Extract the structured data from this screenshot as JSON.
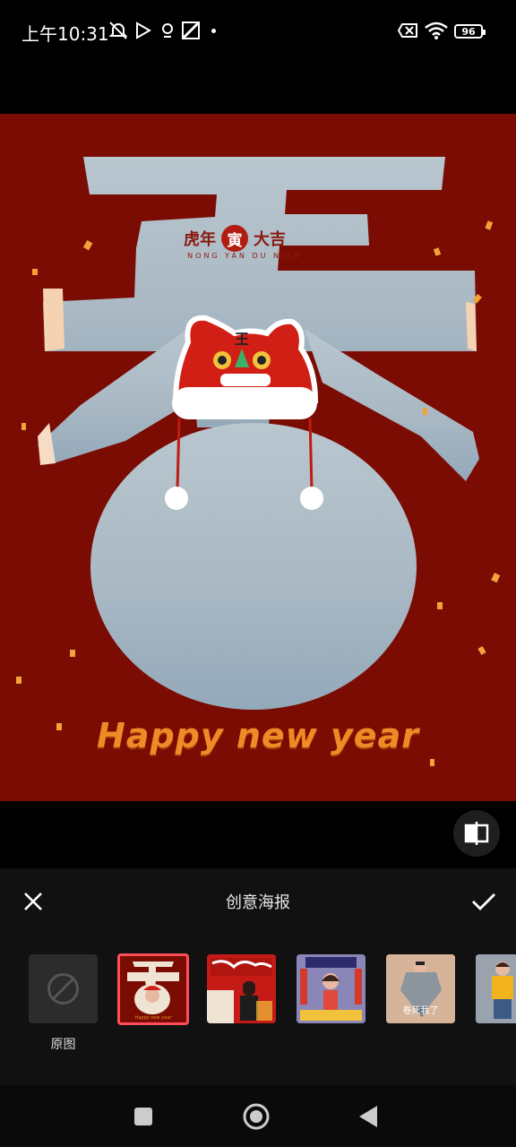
{
  "status_bar": {
    "time": "上午10:31",
    "battery_level": "96",
    "icons": [
      "notification-off-icon",
      "play-store-icon",
      "location-icon",
      "gallery-icon",
      "sim-off-icon",
      "wifi-icon",
      "battery-icon"
    ]
  },
  "poster": {
    "title_left": "虎年",
    "title_badge": "寅",
    "title_right": "大吉",
    "title_pinyin": "NONG YAN DU NIAN",
    "greeting": "Happy new year",
    "colors": {
      "background": "#7a0c03",
      "greeting": "#f08a26"
    }
  },
  "editor": {
    "title": "创意海报",
    "close_icon": "close-icon",
    "confirm_icon": "check-icon",
    "compare_icon": "compare-icon"
  },
  "templates": {
    "original_label": "原图",
    "items": [
      {
        "name": "original",
        "selected": false
      },
      {
        "name": "spring-tiger-poster",
        "selected": true
      },
      {
        "name": "tiger-year-poster",
        "selected": false
      },
      {
        "name": "new-year-joy-poster",
        "selected": false
      },
      {
        "name": "speech-bubble-poster",
        "caption": "卷死我了",
        "selected": false
      },
      {
        "name": "yellow-outfit-poster",
        "selected": false
      }
    ],
    "accent_color": "#ff4d5a"
  },
  "nav_bar": {
    "icons": [
      "recents-square-icon",
      "home-circle-icon",
      "back-triangle-icon"
    ]
  }
}
